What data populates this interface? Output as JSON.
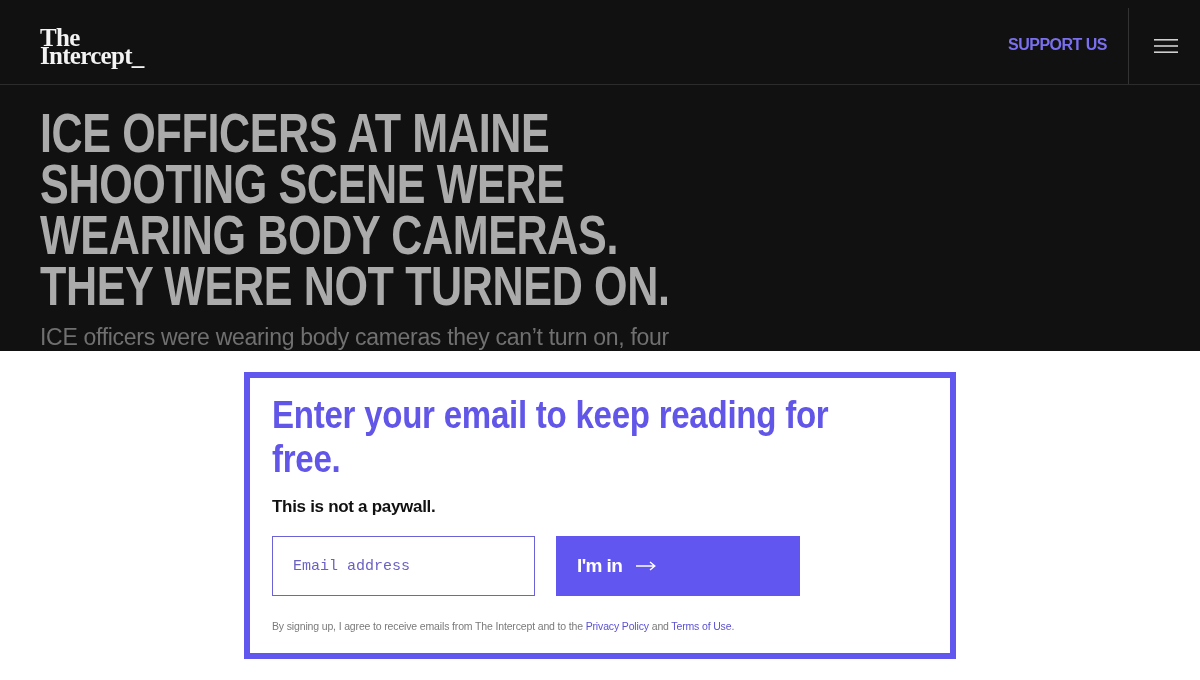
{
  "header": {
    "logo": {
      "lines": [
        "The",
        "Intercept_"
      ]
    },
    "support_link": "SUPPORT US"
  },
  "article": {
    "headline": "ICE OFFICERS AT MAINE SHOOTING SCENE WERE WEARING BODY CAMERAS. THEY WERE NOT TURNED ON.",
    "dek": "ICE officers were wearing body cameras they can’t turn on, four"
  },
  "signup_gate": {
    "heading": "Enter your email to keep reading for free.",
    "subheading": "This is not a paywall.",
    "email_field": {
      "placeholder": "Email address"
    },
    "submit_button": {
      "label": "I'm in"
    },
    "legal": [
      {
        "kind": "text",
        "text": "By signing up, I agree to receive emails from The Intercept and to the "
      },
      {
        "kind": "link",
        "text": "Privacy Policy"
      },
      {
        "kind": "text",
        "text": " and "
      },
      {
        "kind": "link",
        "text": "Terms of Use"
      },
      {
        "kind": "text",
        "text": "."
      }
    ]
  }
}
